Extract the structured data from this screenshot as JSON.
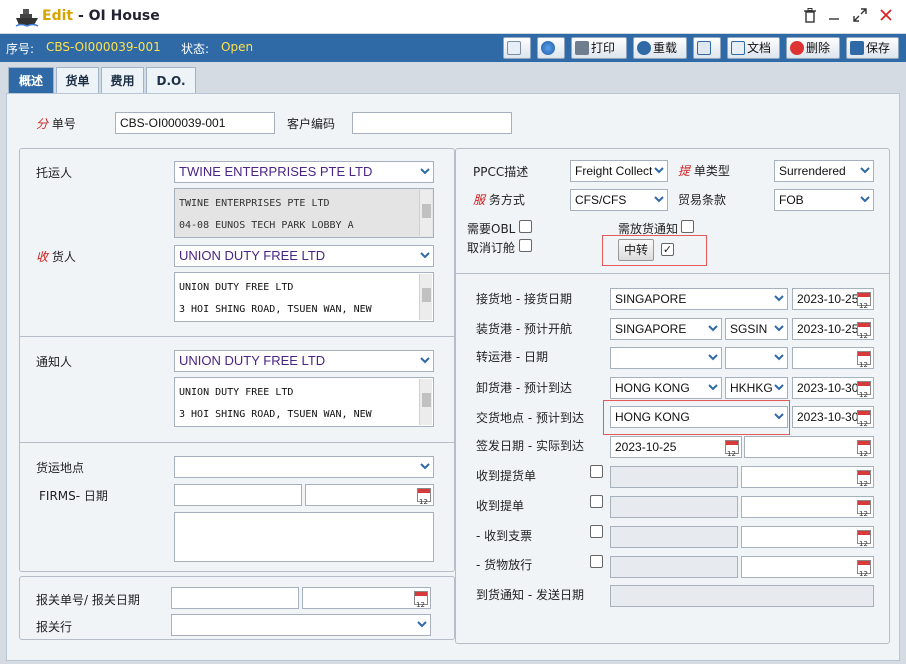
{
  "window": {
    "edit_label": "Edit",
    "title_sep": " - ",
    "title": "OI House"
  },
  "status": {
    "seq_label": "序号:",
    "seq_value": "CBS-OI000039-001",
    "state_label": "状态:",
    "state_value": "Open"
  },
  "toolbar": {
    "print_label": "打印",
    "reload_label": "重载",
    "doc_label": "文档",
    "delete_label": "删除",
    "save_label": "保存"
  },
  "tabs": [
    "概述",
    "货单",
    "费用",
    "D.O."
  ],
  "header": {
    "no_req": "分",
    "no_label": " 单号",
    "no_value": "CBS-OI000039-001",
    "client_code_label": "客户编码",
    "client_code_value": ""
  },
  "shipper": {
    "label": "托运人",
    "name": "TWINE ENTERPRISES PTE LTD",
    "addr1": "TWINE ENTERPRISES PTE LTD",
    "addr2": "04-08 EUNOS TECH PARK LOBBY A"
  },
  "consignee": {
    "req": "收",
    "label": " 货人",
    "name": "UNION DUTY FREE LTD",
    "addr1": "UNION DUTY FREE LTD",
    "addr2": "3 HOI SHING ROAD, TSUEN WAN, NEW"
  },
  "notify": {
    "label": "通知人",
    "name": "UNION DUTY FREE LTD",
    "addr1": "UNION DUTY FREE LTD",
    "addr2": "3 HOI SHING ROAD, TSUEN WAN, NEW"
  },
  "cargo": {
    "place_label": "货运地点",
    "firms_label": "FIRMS- 日期"
  },
  "customs": {
    "no_date_label": "报关单号/ 报关日期",
    "broker_label": "报关行"
  },
  "terms": {
    "ppcc_label": "PPCC描述",
    "ppcc_value": "Freight Collect",
    "bl_type_req": "提",
    "bl_type_label": " 单类型",
    "bl_type_value": "Surrendered",
    "service_req": "服",
    "service_label": " 务方式",
    "service_value": "CFS/CFS",
    "trade_label": "贸易条款",
    "trade_value": "FOB",
    "need_obl_label": "需要OBL",
    "need_release_label": "需放货通知",
    "cancel_label": "取消订舱",
    "transship_label": "中转",
    "transship_checked": "✓"
  },
  "routing": {
    "receipt_label": "接货地 - 接货日期",
    "receipt_place": "SINGAPORE",
    "receipt_date": "2023-10-25",
    "load_label": "装货港 - 预计开航",
    "load_port": "SINGAPORE",
    "load_code": "SGSIN",
    "etd": "2023-10-25",
    "transit_label": "转运港 - 日期",
    "discharge_label": "卸货港 - 预计到达",
    "discharge_port": "HONG KONG",
    "discharge_code": "HKHKG",
    "eta": "2023-10-30",
    "delivery_label": "交货地点 - 预计到达",
    "delivery_place": "HONG KONG",
    "delivery_eta": "2023-10-30",
    "issue_label": "签发日期 - 实际到达",
    "issue_date": "2023-10-25",
    "recv_bl_label": "收到提货单",
    "recv_bill_label": "收到提单",
    "recv_check_label": "- 收到支票",
    "cargo_release_label": "- 货物放行",
    "arrival_notice_label": "到货通知 - 发送日期"
  }
}
